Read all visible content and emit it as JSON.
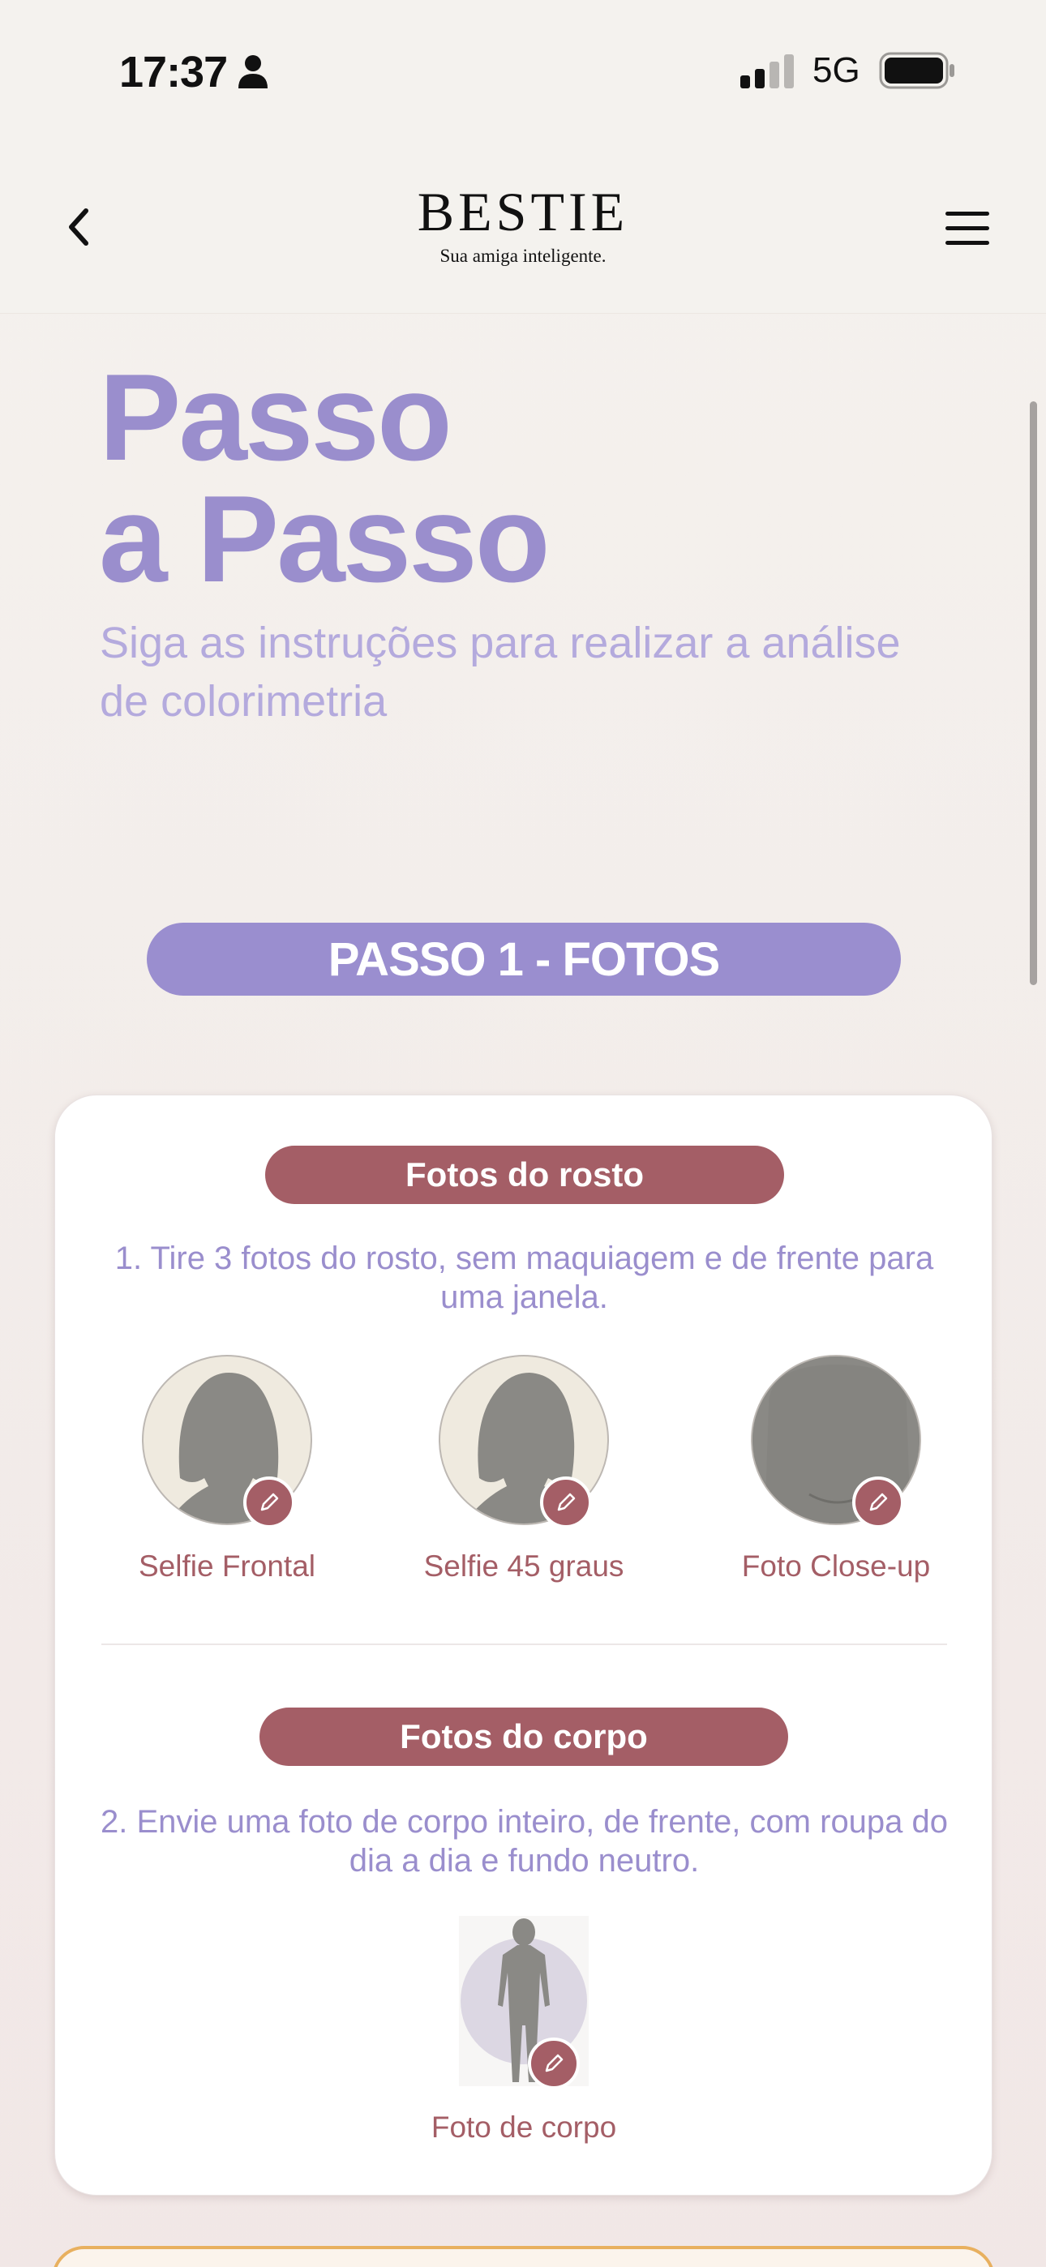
{
  "status_bar": {
    "time": "17:37",
    "network": "5G"
  },
  "header": {
    "logo": "BESTIE",
    "tagline": "Sua amiga inteligente."
  },
  "hero": {
    "title_line1": "Passo",
    "title_line2": "a Passo",
    "subtitle": "Siga as instruções para realizar a análise de colorimetria"
  },
  "step": {
    "label": "PASSO 1 - FOTOS"
  },
  "face_section": {
    "title": "Fotos do rosto",
    "instruction": "1. Tire 3 fotos do rosto, sem maquiagem e de frente para uma janela.",
    "slots": [
      {
        "label": "Selfie Frontal"
      },
      {
        "label": "Selfie 45 graus"
      },
      {
        "label": "Foto Close-up"
      }
    ]
  },
  "body_section": {
    "title": "Fotos do corpo",
    "instruction": "2. Envie uma foto de corpo inteiro, de frente, com roupa do dia a dia e fundo neutro.",
    "slots": [
      {
        "label": "Foto de corpo"
      }
    ]
  },
  "colors": {
    "lavender": "#9a8ecd",
    "rose": "#a45e66",
    "accent_border": "#e8b05f"
  }
}
